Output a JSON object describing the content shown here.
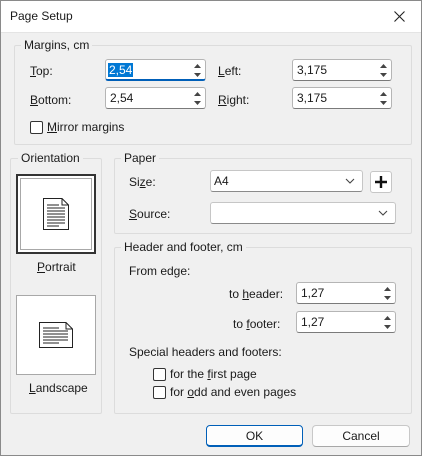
{
  "window": {
    "title": "Page Setup",
    "close_icon": "close-icon"
  },
  "margins": {
    "legend": "Margins, cm",
    "top": {
      "label_key": "T",
      "label_rest": "op:",
      "value": "2,54"
    },
    "bottom": {
      "label_key": "B",
      "label_rest": "ottom:",
      "value": "2,54"
    },
    "left": {
      "label_key": "L",
      "label_rest": "eft:",
      "value": "3,175"
    },
    "right": {
      "label_key": "R",
      "label_rest": "ight:",
      "value": "3,175"
    },
    "mirror": {
      "label_key": "M",
      "label_rest": "irror margins",
      "checked": false
    }
  },
  "orientation": {
    "legend": "Orientation",
    "portrait": {
      "label_key": "P",
      "label_rest": "ortrait",
      "selected": true
    },
    "landscape": {
      "label_key": "L",
      "label_rest": "andscape",
      "selected": false
    }
  },
  "paper": {
    "legend": "Paper",
    "size": {
      "label_pre": "Si",
      "label_key": "z",
      "label_rest": "e:",
      "value": "A4"
    },
    "source": {
      "label_key": "S",
      "label_rest": "ource:",
      "value": ""
    },
    "add_icon": "plus-icon"
  },
  "header_footer": {
    "legend": "Header and footer, cm",
    "from_edge": "From edge:",
    "to_header": {
      "label_pre": "to ",
      "label_key": "h",
      "label_rest": "eader:",
      "value": "1,27"
    },
    "to_footer": {
      "label_pre": "to ",
      "label_key": "f",
      "label_rest": "ooter:",
      "value": "1,27"
    },
    "special": "Special headers and footers:",
    "first_page": {
      "label_pre": "for the ",
      "label_key": "f",
      "label_rest": "irst page",
      "checked": false
    },
    "odd_even": {
      "label_pre": "for ",
      "label_key": "o",
      "label_rest": "dd and even pages",
      "checked": false
    }
  },
  "buttons": {
    "ok": "OK",
    "cancel": "Cancel"
  }
}
